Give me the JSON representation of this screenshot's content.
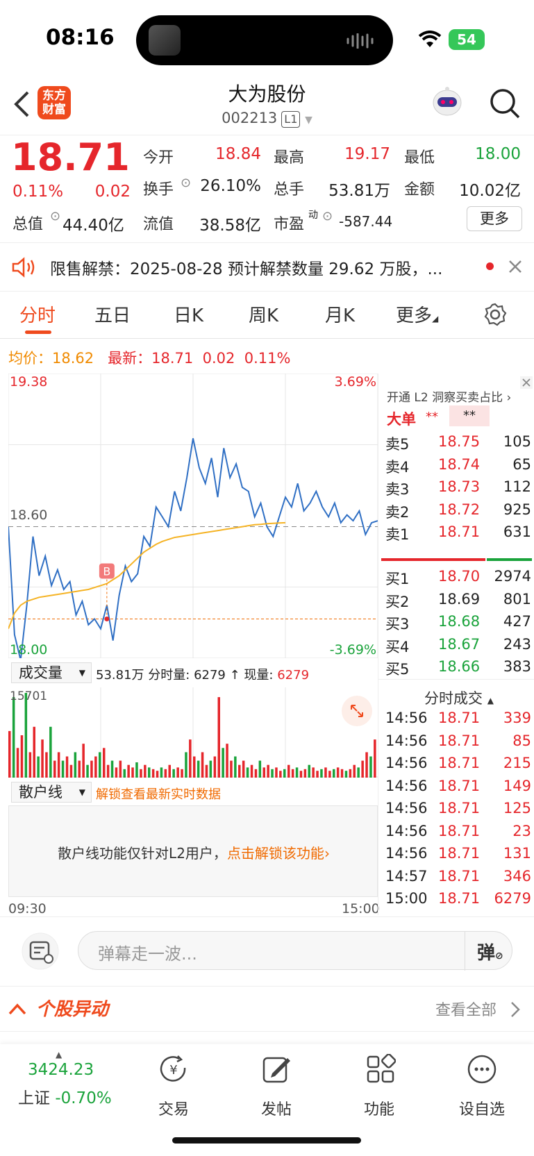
{
  "status_bar": {
    "time": "08:16",
    "battery": "54"
  },
  "header": {
    "logo_line1": "东方",
    "logo_line2": "财富",
    "stock_name": "大为股份",
    "stock_code": "002213",
    "level": "L1"
  },
  "quote": {
    "price": "18.71",
    "change_pct": "0.11%",
    "change": "0.02",
    "open_label": "今开",
    "open": "18.84",
    "high_label": "最高",
    "high": "19.17",
    "low_label": "最低",
    "low": "18.00",
    "turnover_label": "换手",
    "turnover": "26.10%",
    "volume_label": "总手",
    "volume": "53.81万",
    "amount_label": "金额",
    "amount": "10.02亿",
    "mktcap_label": "总值",
    "mktcap": "44.40亿",
    "float_label": "流值",
    "float_cap": "38.58亿",
    "pe_label": "市盈",
    "pe_sup": "动",
    "pe": "-587.44",
    "more_button": "更多"
  },
  "notice": {
    "text": "限售解禁：2025-08-28 预计解禁数量 29.62 万股，..."
  },
  "tabs": [
    "分时",
    "五日",
    "日K",
    "周K",
    "月K",
    "更多"
  ],
  "avg_line": {
    "avg_label": "均价：",
    "avg": "18.62",
    "latest_label": "最新：",
    "latest": "18.71",
    "chg": "0.02",
    "pct": "0.11%"
  },
  "chart_data": {
    "type": "line",
    "y_top": "19.38",
    "y_mid": "18.60",
    "y_bottom": "18.00",
    "pct_top": "3.69%",
    "pct_bottom": "-3.69%",
    "ylim": [
      17.93,
      19.38
    ],
    "x_start": "09:30",
    "x_end": "15:00",
    "series": [
      {
        "name": "price",
        "values": [
          18.6,
          18.05,
          17.92,
          18.2,
          18.55,
          18.35,
          18.45,
          18.3,
          18.38,
          18.28,
          18.32,
          18.15,
          18.22,
          18.1,
          18.13,
          18.08,
          18.2,
          18.02,
          18.25,
          18.4,
          18.32,
          18.36,
          18.55,
          18.5,
          18.7,
          18.65,
          18.6,
          18.78,
          18.68,
          18.85,
          19.05,
          18.9,
          18.82,
          18.95,
          18.75,
          19.0,
          18.85,
          18.92,
          18.8,
          18.78,
          18.65,
          18.72,
          18.6,
          18.55,
          18.65,
          18.75,
          18.7,
          18.82,
          18.68,
          18.72,
          18.78,
          18.7,
          18.65,
          18.72,
          18.62,
          18.66,
          18.63,
          18.68,
          18.56,
          18.62,
          18.63
        ]
      },
      {
        "name": "avg",
        "values": [
          18.08,
          18.16,
          18.2,
          18.22,
          18.23,
          18.24,
          18.245,
          18.25,
          18.255,
          18.26,
          18.265,
          18.27,
          18.275,
          18.28,
          18.29,
          18.3,
          18.31,
          18.33,
          18.35,
          18.38,
          18.41,
          18.44,
          18.47,
          18.49,
          18.51,
          18.525,
          18.535,
          18.545,
          18.55,
          18.555,
          18.56,
          18.565,
          18.57,
          18.575,
          18.58,
          18.585,
          18.59,
          18.595,
          18.6,
          18.605,
          18.61,
          18.612,
          18.615,
          18.617,
          18.619,
          18.62
        ]
      }
    ],
    "buy_marker": "B",
    "buy_price": 18.13
  },
  "volume": {
    "selector": "成交量",
    "total": "53.81万",
    "min_vol_label": "分时量:",
    "min_vol": "6279",
    "cur_label": "现量:",
    "cur_vol": "6279",
    "max": "15701",
    "bars": [
      0.55,
      0.95,
      0.35,
      0.5,
      1.0,
      0.3,
      0.6,
      0.25,
      0.45,
      0.3,
      0.6,
      0.2,
      0.3,
      0.2,
      0.25,
      0.15,
      0.3,
      0.2,
      0.4,
      0.15,
      0.2,
      0.25,
      0.3,
      0.35,
      0.15,
      0.2,
      0.12,
      0.2,
      0.1,
      0.15,
      0.12,
      0.18,
      0.1,
      0.15,
      0.12,
      0.1,
      0.08,
      0.12,
      0.1,
      0.15,
      0.1,
      0.12,
      0.1,
      0.3,
      0.45,
      0.25,
      0.2,
      0.3,
      0.15,
      0.2,
      0.25,
      0.95,
      0.35,
      0.4,
      0.2,
      0.25,
      0.15,
      0.2,
      0.12,
      0.15,
      0.1,
      0.2,
      0.12,
      0.15,
      0.1,
      0.12,
      0.08,
      0.1,
      0.15,
      0.1,
      0.12,
      0.08,
      0.1,
      0.15,
      0.12,
      0.08,
      0.1,
      0.12,
      0.08,
      0.1,
      0.12,
      0.1,
      0.08,
      0.1,
      0.15,
      0.12,
      0.2,
      0.3,
      0.25,
      0.45
    ]
  },
  "retail": {
    "selector": "散户线",
    "unlock_hint": "解锁查看最新实时数据",
    "lock_text": "散户线功能仅针对L2用户，",
    "lock_link": "点击解锁该功能"
  },
  "panel": {
    "l2_title": "开通 L2 洞察买卖占比",
    "big_order": "大单",
    "stars": "**",
    "asks": [
      {
        "l": "卖5",
        "p": "18.75",
        "v": "105"
      },
      {
        "l": "卖4",
        "p": "18.74",
        "v": "65"
      },
      {
        "l": "卖3",
        "p": "18.73",
        "v": "112"
      },
      {
        "l": "卖2",
        "p": "18.72",
        "v": "925"
      },
      {
        "l": "卖1",
        "p": "18.71",
        "v": "631"
      }
    ],
    "bids": [
      {
        "l": "买1",
        "p": "18.70",
        "v": "2974"
      },
      {
        "l": "买2",
        "p": "18.69",
        "v": "801"
      },
      {
        "l": "买3",
        "p": "18.68",
        "v": "427"
      },
      {
        "l": "买4",
        "p": "18.67",
        "v": "243"
      },
      {
        "l": "买5",
        "p": "18.66",
        "v": "383"
      }
    ],
    "trades_title": "分时成交",
    "trades": [
      {
        "t": "14:56",
        "p": "18.71",
        "v": "339"
      },
      {
        "t": "14:56",
        "p": "18.71",
        "v": "85"
      },
      {
        "t": "14:56",
        "p": "18.71",
        "v": "215"
      },
      {
        "t": "14:56",
        "p": "18.71",
        "v": "149"
      },
      {
        "t": "14:56",
        "p": "18.71",
        "v": "125"
      },
      {
        "t": "14:56",
        "p": "18.71",
        "v": "23"
      },
      {
        "t": "14:56",
        "p": "18.71",
        "v": "131"
      },
      {
        "t": "14:57",
        "p": "18.71",
        "v": "346"
      },
      {
        "t": "15:00",
        "p": "18.71",
        "v": "6279"
      }
    ]
  },
  "danmaku": {
    "placeholder": "弹幕走一波...",
    "button": "弹"
  },
  "stock_move": {
    "title": "个股异动",
    "view_all": "查看全部"
  },
  "tabbar": {
    "index_value": "3424.23",
    "index_name": "上证",
    "index_pct": "-0.70%",
    "items": [
      "交易",
      "发帖",
      "功能",
      "设自选"
    ]
  }
}
